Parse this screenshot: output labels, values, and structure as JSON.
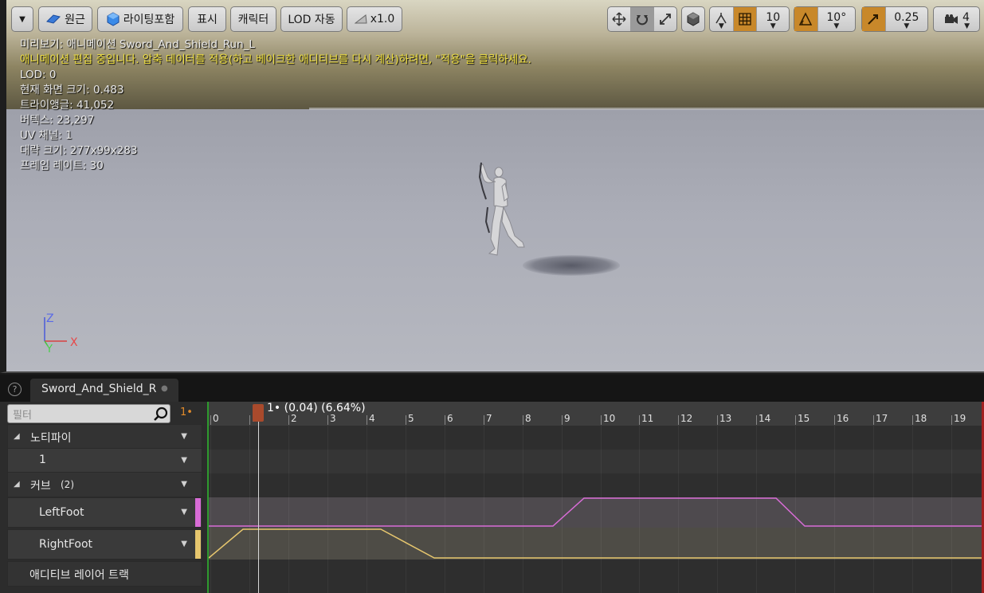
{
  "toolbar": {
    "perspective_label": "원근",
    "lighting_label": "라이팅포함",
    "show_label": "표시",
    "character_label": "캐릭터",
    "lod_label": "LOD 자동",
    "speed_label": "x1.0",
    "grid_snap_value": "10",
    "rotation_snap_value": "10°",
    "scale_snap_value": "0.25",
    "camera_speed_value": "4",
    "active_color": "#c8882a"
  },
  "stats": {
    "preview": "미리보기: 애니메이션 Sword_And_Shield_Run_L",
    "warning": "애니메이션 편집 중입니다. 압축 데이터를 적용(하고 베이크한 애디티브를 다시 계산)하려면, \"적용\"을 클릭하세요.",
    "lod": "LOD: 0",
    "screen_size": "현재 화면 크기: 0.483",
    "triangles": "트라이앵글: 41,052",
    "vertices": "버텍스: 23,297",
    "uv_channels": "UV 채널: 1",
    "bounds": "대략 크기: 277x99x283",
    "frame_rate": "프레임 레이트: 30"
  },
  "gizmo": {
    "z": "Z",
    "y": "Y",
    "x": "X"
  },
  "tab": {
    "title": "Sword_And_Shield_R",
    "help": "?"
  },
  "filter": {
    "placeholder": "필터",
    "frame_marker": "1•"
  },
  "tracks": {
    "notifies_label": "노티파이",
    "notify_track": "1",
    "curves_label": "커브",
    "curves_count": "(2)",
    "left_foot": "LeftFoot",
    "right_foot": "RightFoot",
    "additive_layer": "애디티브 레이어 트랙",
    "left_foot_color": "#d86cd6",
    "right_foot_color": "#e6c66e"
  },
  "timeline": {
    "scrub_label": "1• (0.04) (6.64%)",
    "frames": [
      "0",
      "1",
      "2",
      "3",
      "4",
      "5",
      "6",
      "7",
      "8",
      "9",
      "10",
      "11",
      "12",
      "13",
      "14",
      "15",
      "16",
      "17",
      "18",
      "19"
    ]
  }
}
